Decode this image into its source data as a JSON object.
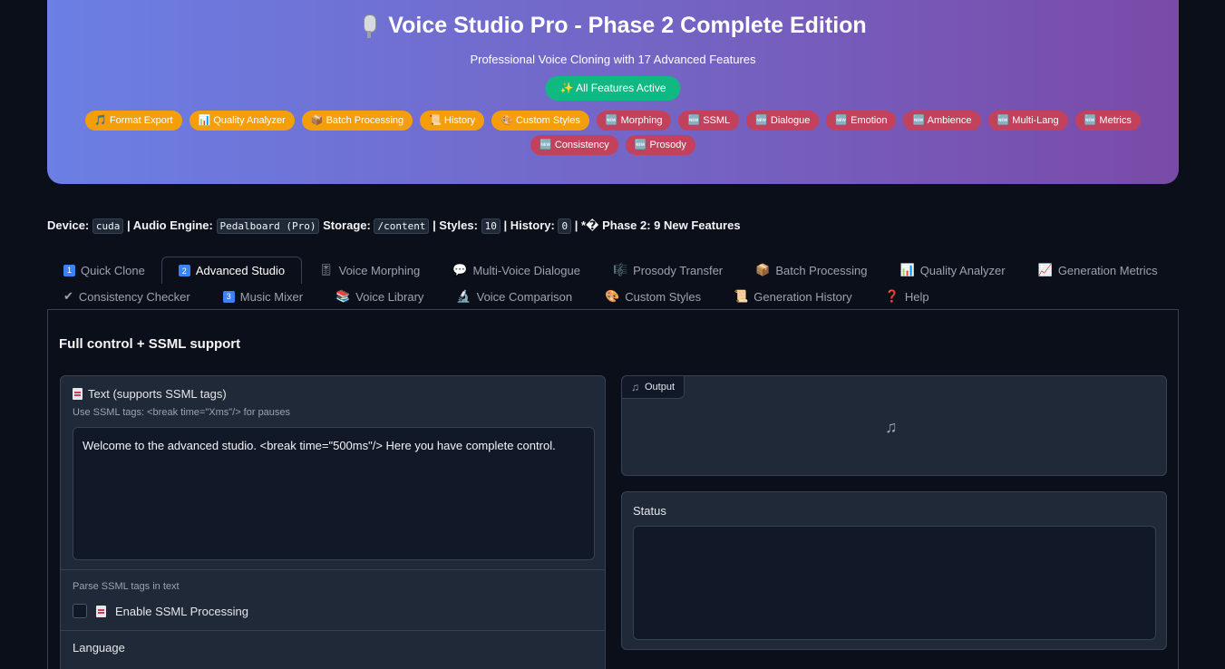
{
  "header": {
    "title": "Voice Studio Pro - Phase 2 Complete Edition",
    "subtitle": "Professional Voice Cloning with 17 Advanced Features",
    "active_pill": "✨ All Features Active",
    "badges": [
      {
        "label": "🎵 Format Export",
        "color": "orange"
      },
      {
        "label": "📊 Quality Analyzer",
        "color": "orange"
      },
      {
        "label": "📦 Batch Processing",
        "color": "orange"
      },
      {
        "label": "📜 History",
        "color": "orange"
      },
      {
        "label": "🎨 Custom Styles",
        "color": "orange"
      },
      {
        "label": "🆕 Morphing",
        "color": "red"
      },
      {
        "label": "🆕 SSML",
        "color": "red"
      },
      {
        "label": "🆕 Dialogue",
        "color": "red"
      },
      {
        "label": "🆕 Emotion",
        "color": "red"
      },
      {
        "label": "🆕 Ambience",
        "color": "red"
      },
      {
        "label": "🆕 Multi-Lang",
        "color": "red"
      },
      {
        "label": "🆕 Metrics",
        "color": "red"
      },
      {
        "label": "🆕 Consistency",
        "color": "red"
      },
      {
        "label": "🆕 Prosody",
        "color": "red"
      }
    ]
  },
  "info": {
    "device_label": "Device:",
    "device_value": "cuda",
    "engine_label": "| Audio Engine:",
    "engine_value": "Pedalboard (Pro)",
    "storage_label": "Storage:",
    "storage_value": "/content",
    "styles_label": "| Styles:",
    "styles_value": "10",
    "history_label": "| History:",
    "history_value": "0",
    "phase_text": "| *� Phase 2: 9 New Features"
  },
  "tabs": {
    "row1": [
      {
        "icon": "1",
        "label": "Quick Clone",
        "active": false
      },
      {
        "icon": "2",
        "label": "Advanced Studio",
        "active": true
      },
      {
        "icon": "🎚",
        "label": "Voice Morphing",
        "active": false
      },
      {
        "icon": "💬",
        "label": "Multi-Voice Dialogue",
        "active": false
      },
      {
        "icon": "🎼",
        "label": "Prosody Transfer",
        "active": false
      },
      {
        "icon": "📦",
        "label": "Batch Processing",
        "active": false
      },
      {
        "icon": "📊",
        "label": "Quality Analyzer",
        "active": false
      },
      {
        "icon": "📈",
        "label": "Generation Metrics",
        "active": false
      }
    ],
    "row2": [
      {
        "icon": "✔",
        "label": "Consistency Checker",
        "active": false
      },
      {
        "icon": "3",
        "label": "Music Mixer",
        "active": false
      },
      {
        "icon": "📚",
        "label": "Voice Library",
        "active": false
      },
      {
        "icon": "🔬",
        "label": "Voice Comparison",
        "active": false
      },
      {
        "icon": "🎨",
        "label": "Custom Styles",
        "active": false
      },
      {
        "icon": "📜",
        "label": "Generation History",
        "active": false
      },
      {
        "icon": "❓",
        "label": "Help",
        "active": false
      }
    ]
  },
  "panel": {
    "heading": "Full control + SSML support",
    "text_label": "Text (supports SSML tags)",
    "text_hint": "Use SSML tags: <break time=\"Xms\"/> for pauses",
    "text_value": "Welcome to the advanced studio. <break time=\"500ms\"/> Here you have complete control.",
    "ssml_hint": "Parse SSML tags in text",
    "ssml_checkbox_label": "Enable SSML Processing",
    "language_label": "Language",
    "output_label": "Output",
    "status_label": "Status"
  }
}
